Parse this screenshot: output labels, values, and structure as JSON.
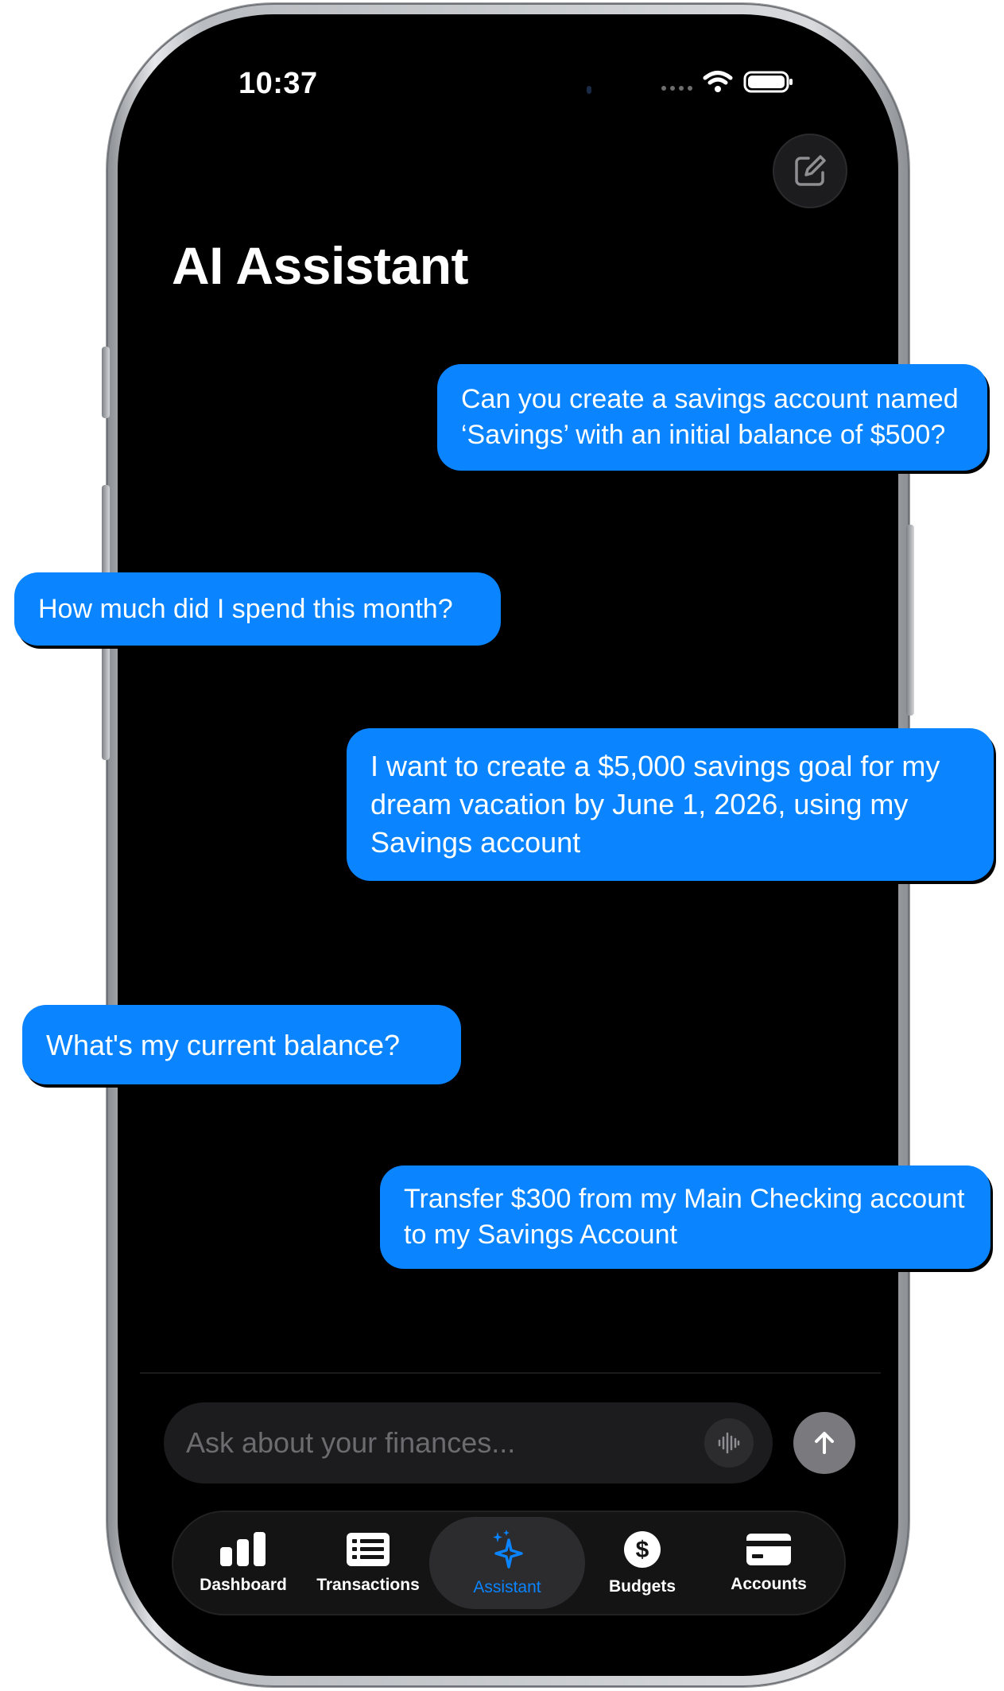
{
  "status_bar": {
    "time": "10:37"
  },
  "header": {
    "title": "AI Assistant"
  },
  "messages": [
    {
      "text": "Can you create a savings account named\n‘Savings’ with an initial balance of $500?"
    },
    {
      "text": "How much did I spend this month?"
    },
    {
      "text": "I want to create a $5,000 savings goal for my\ndream vacation by June 1, 2026, using my\nSavings account"
    },
    {
      "text": "What's my current balance?"
    },
    {
      "text": "Transfer $300 from my Main Checking account\nto my Savings Account"
    }
  ],
  "composer": {
    "placeholder": "Ask about your finances...",
    "value": ""
  },
  "tabs": [
    {
      "label": "Dashboard",
      "icon": "bar-chart-icon",
      "active": false
    },
    {
      "label": "Transactions",
      "icon": "list-icon",
      "active": false
    },
    {
      "label": "Assistant",
      "icon": "sparkles-icon",
      "active": true
    },
    {
      "label": "Budgets",
      "icon": "dollar-circle-icon",
      "active": false
    },
    {
      "label": "Accounts",
      "icon": "credit-card-icon",
      "active": false
    }
  ],
  "colors": {
    "accent": "#0a84ff",
    "background": "#000000",
    "bubble": "#0a84ff",
    "send_button": "#7a7a7e"
  }
}
